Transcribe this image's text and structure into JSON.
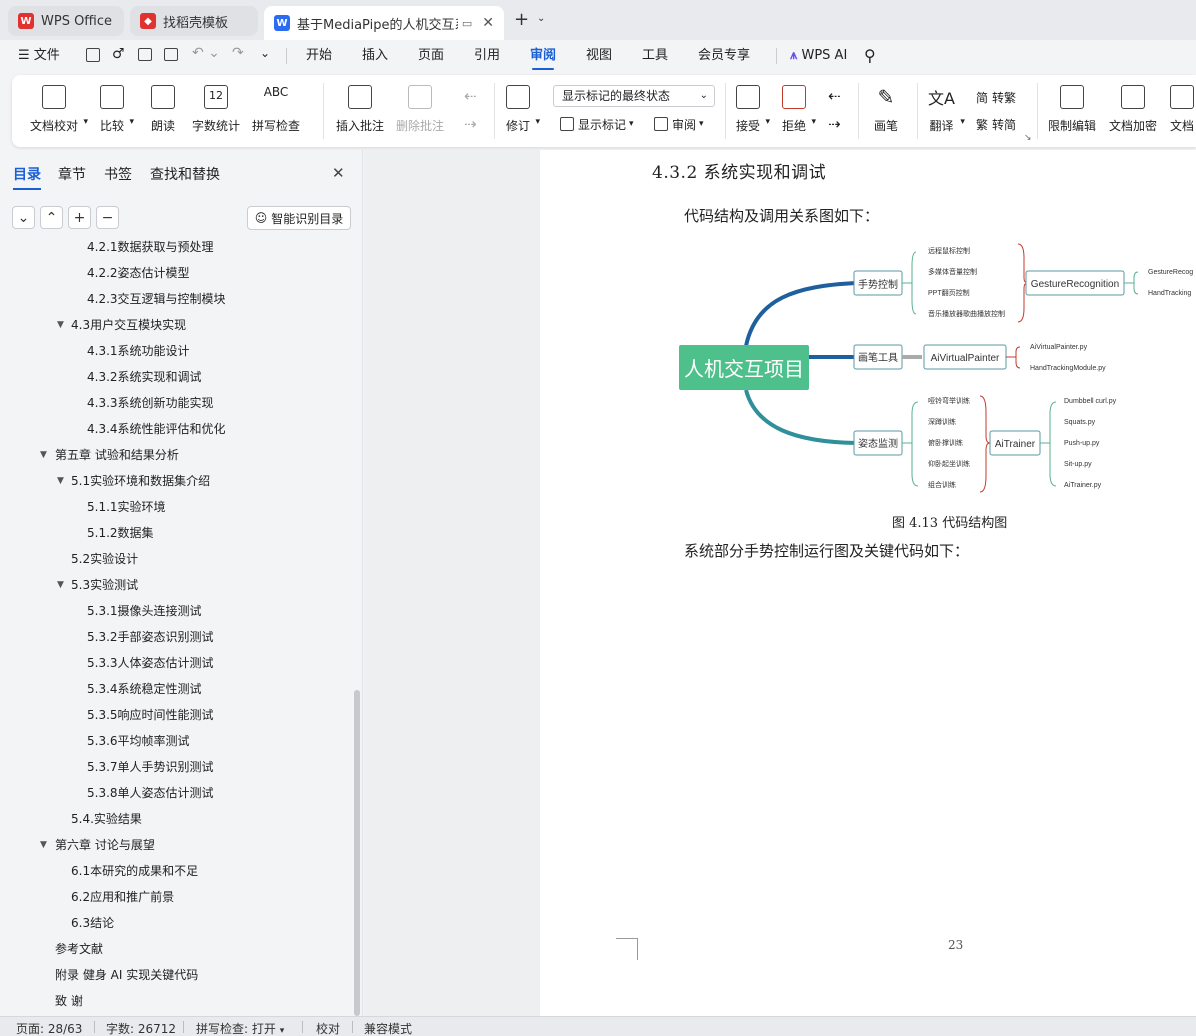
{
  "tabs": [
    {
      "label": "WPS Office",
      "icon": "wps-logo-icon"
    },
    {
      "label": "找稻壳模板",
      "icon": "docer-icon"
    },
    {
      "label": "基于MediaPipe的人机交互系",
      "icon": "word-doc-icon"
    }
  ],
  "menu": {
    "file_label": "文件",
    "items": [
      "开始",
      "插入",
      "页面",
      "引用",
      "审阅",
      "视图",
      "工具",
      "会员专享"
    ],
    "active": "审阅",
    "ai_label": "WPS AI"
  },
  "ribbon": {
    "doc_proof": "文档校对",
    "compare": "比较",
    "read_aloud": "朗读",
    "word_count": "字数统计",
    "spell_check": "拼写检查",
    "insert_comment": "插入批注",
    "delete_comment": "删除批注",
    "revise": "修订",
    "display_mode": "显示标记的最终状态",
    "show_markup": "显示标记",
    "review": "审阅",
    "accept": "接受",
    "reject": "拒绝",
    "pen": "画笔",
    "translate": "翻译",
    "to_traditional": "转繁",
    "to_simplified": "转简",
    "restrict_edit": "限制编辑",
    "doc_encrypt": "文档加密",
    "doc_more": "文档",
    "icon_text_abc": "ABC",
    "icon_text_12": "12"
  },
  "sidebar": {
    "tabs": [
      "目录",
      "章节",
      "书签",
      "查找和替换"
    ],
    "active_tab": "目录",
    "smart_toc_label": "智能识别目录",
    "toc": [
      {
        "label": "4.2.1数据获取与预处理",
        "level": 3
      },
      {
        "label": "4.2.2姿态估计模型",
        "level": 3
      },
      {
        "label": "4.2.3交互逻辑与控制模块",
        "level": 3
      },
      {
        "label": "4.3用户交互模块实现",
        "level": 2,
        "expanded": true
      },
      {
        "label": "4.3.1系统功能设计",
        "level": 3
      },
      {
        "label": "4.3.2系统实现和调试",
        "level": 3
      },
      {
        "label": "4.3.3系统创新功能实现",
        "level": 3
      },
      {
        "label": "4.3.4系统性能评估和优化",
        "level": 3
      },
      {
        "label": "第五章 试验和结果分析",
        "level": 1,
        "expanded": true
      },
      {
        "label": "5.1实验环境和数据集介绍",
        "level": 2,
        "expanded": true
      },
      {
        "label": "5.1.1实验环境",
        "level": 3
      },
      {
        "label": "5.1.2数据集",
        "level": 3
      },
      {
        "label": "5.2实验设计",
        "level": 2
      },
      {
        "label": "5.3实验测试",
        "level": 2,
        "expanded": true
      },
      {
        "label": "5.3.1摄像头连接测试",
        "level": 3
      },
      {
        "label": "5.3.2手部姿态识别测试",
        "level": 3
      },
      {
        "label": "5.3.3人体姿态估计测试",
        "level": 3
      },
      {
        "label": "5.3.4系统稳定性测试",
        "level": 3
      },
      {
        "label": "5.3.5响应时间性能测试",
        "level": 3
      },
      {
        "label": "5.3.6平均帧率测试",
        "level": 3
      },
      {
        "label": "5.3.7单人手势识别测试",
        "level": 3
      },
      {
        "label": "5.3.8单人姿态估计测试",
        "level": 3
      },
      {
        "label": "5.4.实验结果",
        "level": 2
      },
      {
        "label": "第六章 讨论与展望",
        "level": 1,
        "expanded": true
      },
      {
        "label": "6.1本研究的成果和不足",
        "level": 2
      },
      {
        "label": "6.2应用和推广前景",
        "level": 2
      },
      {
        "label": "6.3结论",
        "level": 2
      },
      {
        "label": "参考文献",
        "level": 1
      },
      {
        "label": "附录 健身 AI 实现关键代码",
        "level": 1
      },
      {
        "label": "致 谢",
        "level": 1
      }
    ]
  },
  "document": {
    "heading": "4.3.2 系统实现和调试",
    "intro": "代码结构及调用关系图如下：",
    "caption": "图 4.13 代码结构图",
    "after": "系统部分手势控制运行图及关键代码如下：",
    "page_number": "23"
  },
  "mindmap": {
    "root": "人机交互项目",
    "branches": [
      {
        "label": "手势控制",
        "leaves": [
          "远程鼠标控制",
          "多媒体音量控制",
          "PPT翻页控制",
          "音乐播放器歌曲播放控制"
        ],
        "module": "GestureRecognition",
        "files": [
          "GestureRecog",
          "HandTracking"
        ]
      },
      {
        "label": "画笔工具",
        "module": "AiVirtualPainter",
        "files": [
          "AiVirtualPainter.py",
          "HandTrackingModule.py"
        ]
      },
      {
        "label": "姿态监测",
        "leaves": [
          "哑铃弯举训练",
          "深蹲训练",
          "俯卧撑训练",
          "仰卧起坐训练",
          "组合训练"
        ],
        "module": "AiTrainer",
        "files": [
          "Dumbbell curl.py",
          "Squats.py",
          "Push-up.py",
          "Sit-up.py",
          "AiTrainer.py"
        ]
      }
    ],
    "colors": {
      "root": "#4ec08c",
      "branch1": "#1f5f9e",
      "branch2": "#1f5f9e",
      "branch3": "#2f8f9a",
      "bracket": "#c0392b"
    }
  },
  "status": {
    "page": "页面: 28/63",
    "words": "字数: 26712",
    "spell": "拼写检查: 打开",
    "proof": "校对",
    "compat": "兼容模式"
  },
  "colors": {
    "accent": "#1a5fd6"
  }
}
